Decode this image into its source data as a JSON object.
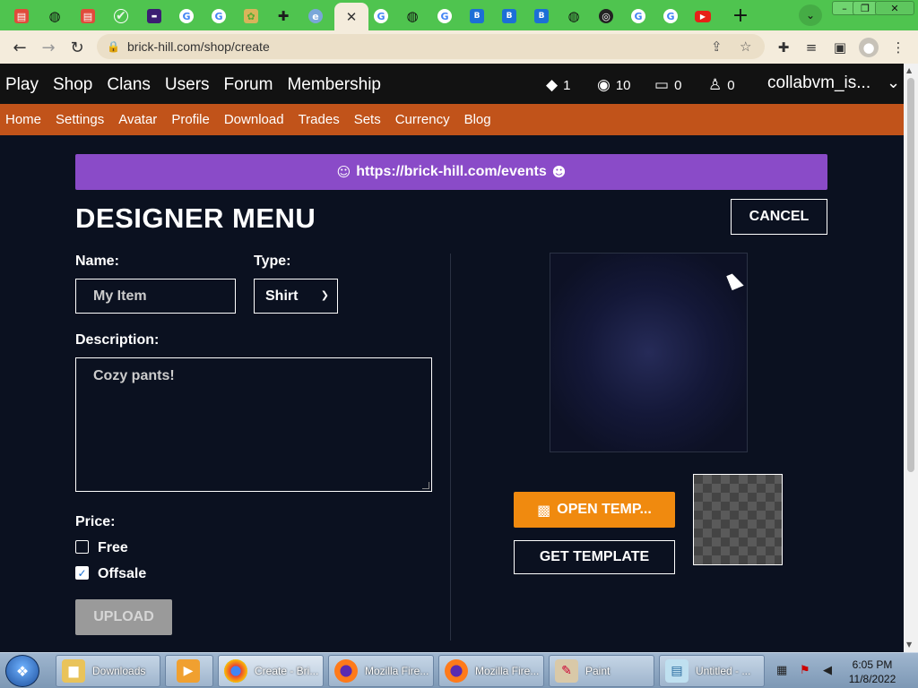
{
  "browser": {
    "tabs": [
      {
        "icon": "red-square-icon"
      },
      {
        "icon": "globe-icon"
      },
      {
        "icon": "red-square-icon"
      },
      {
        "icon": "check-icon"
      },
      {
        "icon": "purple-square-icon"
      },
      {
        "icon": "google-icon"
      },
      {
        "icon": "google-icon"
      },
      {
        "icon": "game-icon"
      },
      {
        "icon": "puzzle-icon"
      },
      {
        "icon": "edge-icon"
      },
      {
        "icon": "close-icon",
        "active": true
      },
      {
        "icon": "google-icon"
      },
      {
        "icon": "globe-icon"
      },
      {
        "icon": "google-icon"
      },
      {
        "icon": "brick-hill-icon"
      },
      {
        "icon": "brick-hill-icon"
      },
      {
        "icon": "brick-hill-icon"
      },
      {
        "icon": "globe-icon"
      },
      {
        "icon": "chrome-icon"
      },
      {
        "icon": "google-icon"
      },
      {
        "icon": "google-icon"
      },
      {
        "icon": "youtube-icon"
      }
    ],
    "url": "brick-hill.com/shop/create"
  },
  "site": {
    "main_nav": [
      "Play",
      "Shop",
      "Clans",
      "Users",
      "Forum",
      "Membership"
    ],
    "stats": {
      "bricks": "1",
      "bits": "10",
      "messages": "0",
      "friends": "0"
    },
    "username": "collabvm_is...",
    "sub_nav": [
      "Home",
      "Settings",
      "Avatar",
      "Profile",
      "Download",
      "Trades",
      "Sets",
      "Currency",
      "Blog"
    ]
  },
  "page": {
    "banner": "https://brick-hill.com/events",
    "title": "DESIGNER MENU",
    "cancel_label": "CANCEL",
    "name_label": "Name:",
    "name_placeholder": "My Item",
    "type_label": "Type:",
    "type_value": "Shirt",
    "description_label": "Description:",
    "description_placeholder": "Cozy pants!",
    "price_label": "Price:",
    "free_label": "Free",
    "free_checked": false,
    "offsale_label": "Offsale",
    "offsale_checked": true,
    "upload_label": "UPLOAD",
    "open_template_label": "OPEN TEMP...",
    "get_template_label": "GET TEMPLATE"
  },
  "taskbar": {
    "items": [
      {
        "label": "Downloads"
      },
      {
        "label": ""
      },
      {
        "label": "Create - Bri..."
      },
      {
        "label": "Mozilla Fire..."
      },
      {
        "label": "Mozilla Fire..."
      },
      {
        "label": "Paint"
      },
      {
        "label": "Untitled - ..."
      }
    ],
    "time": "6:05 PM",
    "date": "11/8/2022"
  },
  "colors": {
    "tabstrip": "#4fc44f",
    "toolbar": "#f4ecdc",
    "site_bar": "#121212",
    "sub_bar": "#c1531a",
    "background": "#0b1120",
    "banner": "#8a4bc8",
    "open_template": "#f08a0f",
    "upload_disabled": "#9a9a9a"
  }
}
